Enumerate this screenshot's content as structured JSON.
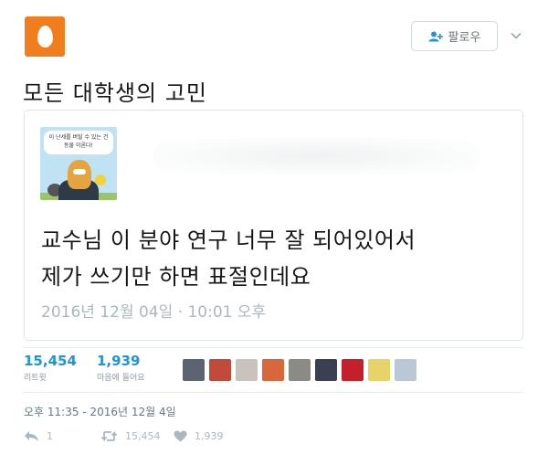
{
  "header": {
    "follow_label": "팔로우"
  },
  "tweet": {
    "text": "모든 대학생의 고민"
  },
  "quoted": {
    "avatar_bubble_text": "이 난세를 버틸 수 있는 건 동물 이론다!",
    "line1": "교수님 이 분야 연구 너무 잘 되어있어서",
    "line2": "제가 쓰기만 하면 표절인데요",
    "date": "2016년 12월 04일 · 10:01 오후"
  },
  "stats": {
    "retweets": {
      "count": "15,454",
      "label": "리트윗"
    },
    "likes": {
      "count": "1,939",
      "label": "마음에 들어요"
    },
    "liker_colors": [
      "#5b6470",
      "#c24a3a",
      "#c9c2bd",
      "#d9663c",
      "#8b8a85",
      "#3b3f52",
      "#c41f2b",
      "#e8d36b",
      "#b9c7d6"
    ]
  },
  "timestamp": "오후 11:35 - 2016년 12월 4일",
  "actions": {
    "reply_count": "1",
    "retweet_count": "15,454",
    "like_count": "1,939"
  },
  "colors": {
    "brand_orange": "#f07d1e",
    "link_blue": "#1b95e0",
    "muted": "#aab8c2"
  }
}
